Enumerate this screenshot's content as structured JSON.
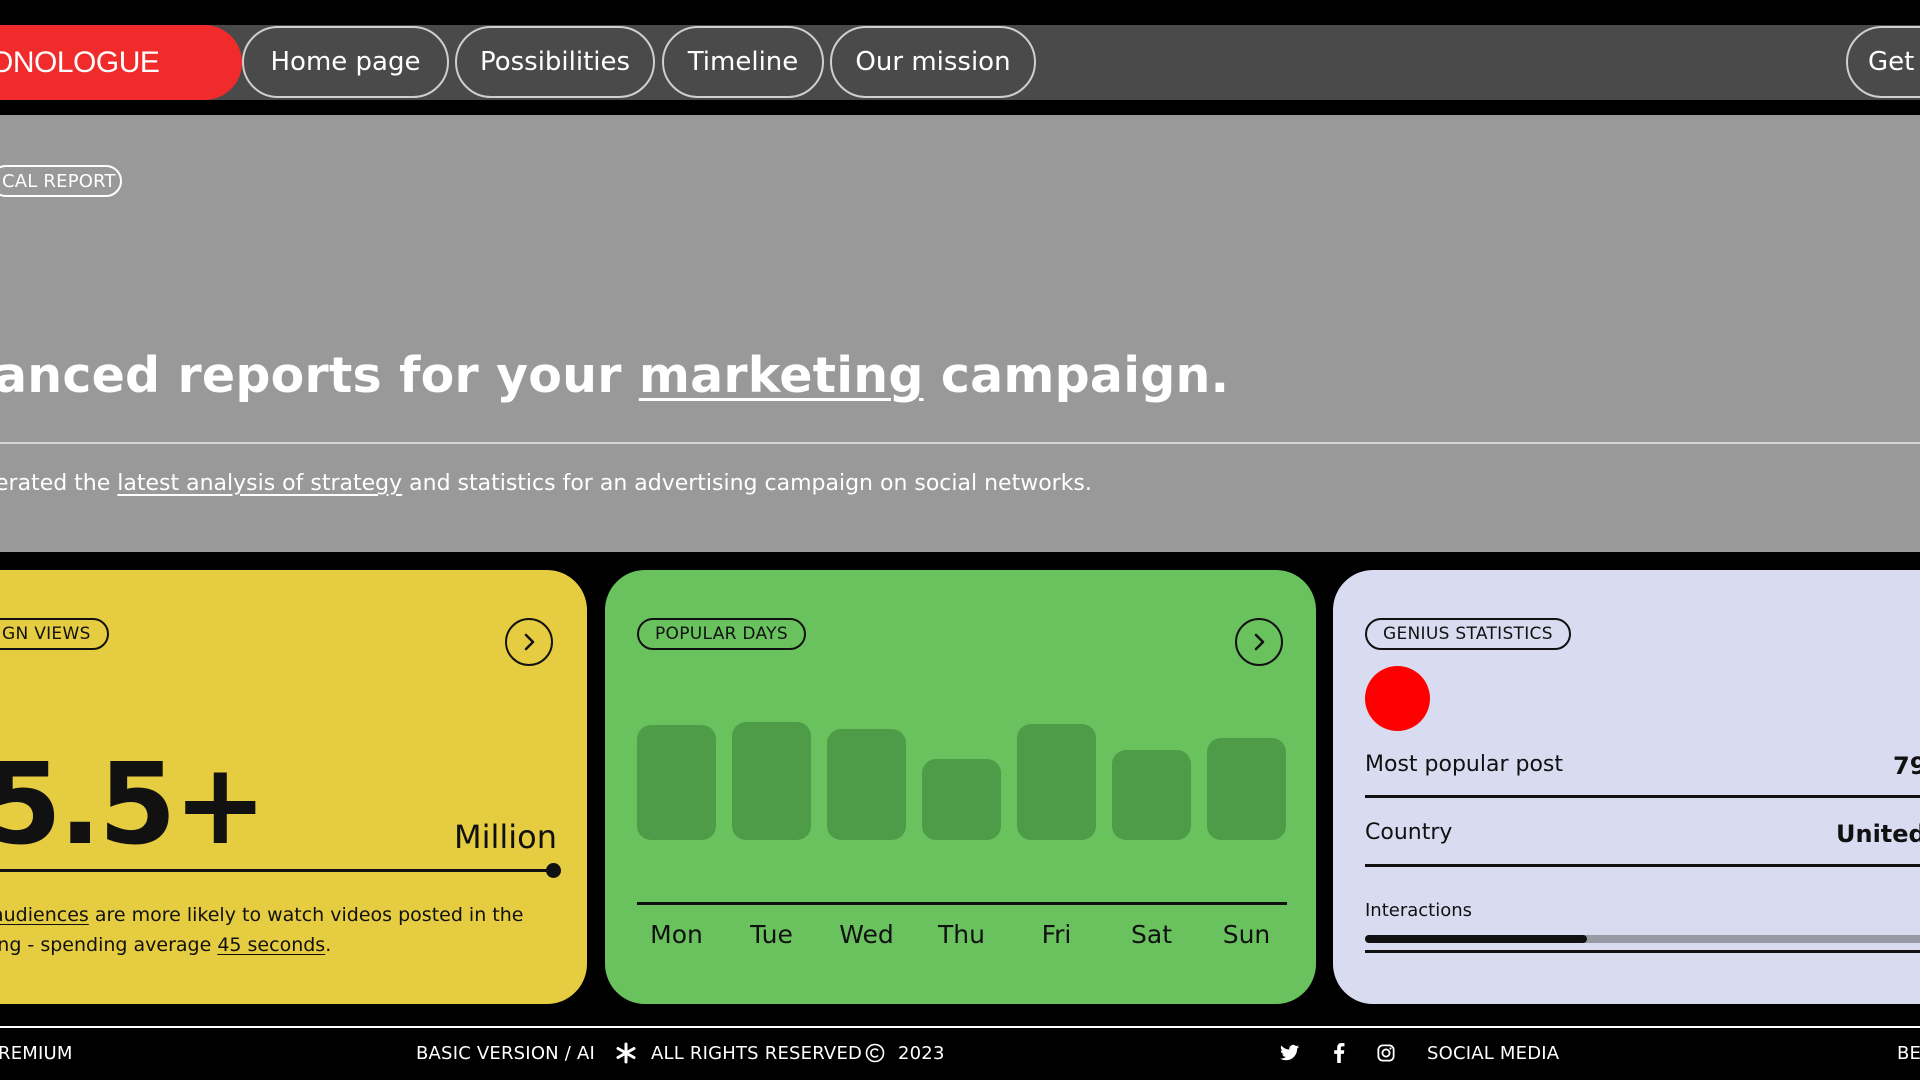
{
  "nav": {
    "brand": "ONOLOGUE",
    "items": [
      "Home page",
      "Possibilities",
      "Timeline",
      "Our mission"
    ],
    "cta": "Get"
  },
  "hero": {
    "tag": "CAL REPORT",
    "headline_pre": "anced reports for your ",
    "headline_link": "marketing",
    "headline_post": " campaign.",
    "sub_pre": "erated the ",
    "sub_link": "latest analysis of strategy",
    "sub_post": " and statistics for an advertising campaign on social networks."
  },
  "views_card": {
    "tag": "GN VIEWS",
    "value": "5.5+",
    "unit": "Million",
    "line1_link": "audiences",
    "line1_rest": " are more likely to watch videos posted in the",
    "line2_pre": "ing - spending average ",
    "line2_link": "45 seconds",
    "line2_post": "."
  },
  "days_card": {
    "tag": "POPULAR DAYS",
    "chart_data": {
      "type": "bar",
      "categories": [
        "Mon",
        "Tue",
        "Wed",
        "Thu",
        "Fri",
        "Sat",
        "Sun"
      ],
      "values": [
        0.82,
        0.84,
        0.79,
        0.58,
        0.83,
        0.64,
        0.73
      ],
      "ylim": [
        0,
        1
      ],
      "bar_color": "#4f9c48"
    }
  },
  "stats_card": {
    "tag": "GENIUS STATISTICS",
    "rows": [
      {
        "label": "Most popular post",
        "value": "79"
      },
      {
        "label": "Country",
        "value": "United"
      }
    ],
    "interactions_label": "Interactions",
    "interactions_fraction": 0.37
  },
  "footer": {
    "left": "REMIUM",
    "basic": "BASIC VERSION / AI",
    "rights": "ALL RIGHTS RESERVED",
    "year": "2023",
    "social": "SOCIAL MEDIA",
    "right": "BE"
  },
  "colors": {
    "brand_red": "#f12b2b",
    "yellow": "#e5cc40",
    "green": "#6ac25e",
    "lavender": "#d9dcf0",
    "hero_gray": "#999999"
  }
}
